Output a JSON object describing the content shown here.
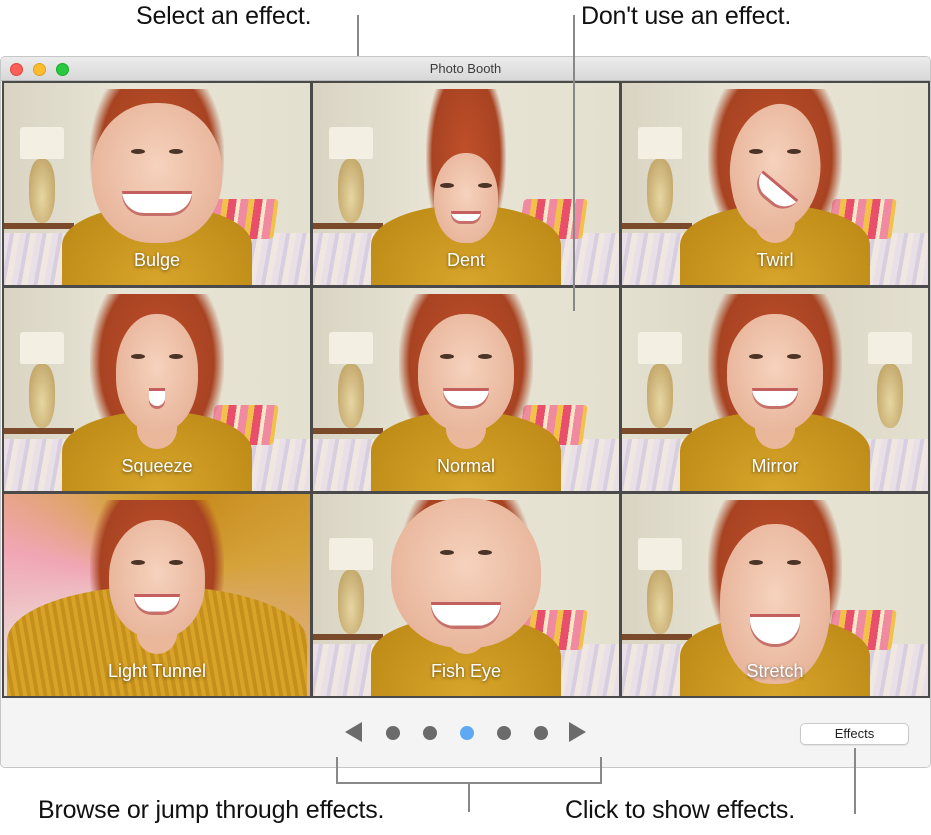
{
  "callouts": {
    "select_effect": "Select an effect.",
    "no_effect": "Don't use an effect.",
    "browse": "Browse or jump through effects.",
    "show_effects": "Click to show effects."
  },
  "window": {
    "title": "Photo Booth",
    "traffic_lights": [
      "close",
      "minimize",
      "zoom"
    ]
  },
  "effects_grid": {
    "cells": [
      {
        "label": "Bulge",
        "variant": "bulge"
      },
      {
        "label": "Dent",
        "variant": "dent"
      },
      {
        "label": "Twirl",
        "variant": "twirl"
      },
      {
        "label": "Squeeze",
        "variant": "squeeze"
      },
      {
        "label": "Normal",
        "variant": "normal"
      },
      {
        "label": "Mirror",
        "variant": "mirror"
      },
      {
        "label": "Light Tunnel",
        "variant": "tunnel"
      },
      {
        "label": "Fish Eye",
        "variant": "fisheye"
      },
      {
        "label": "Stretch",
        "variant": "stretch"
      }
    ]
  },
  "pager": {
    "prev_icon": "triangle-left-icon",
    "next_icon": "triangle-right-icon",
    "page_count": 5,
    "current_page": 3,
    "dot_color": "#6b6b6b",
    "active_dot_color": "#5fa9f2"
  },
  "toolbar": {
    "effects_label": "Effects"
  }
}
